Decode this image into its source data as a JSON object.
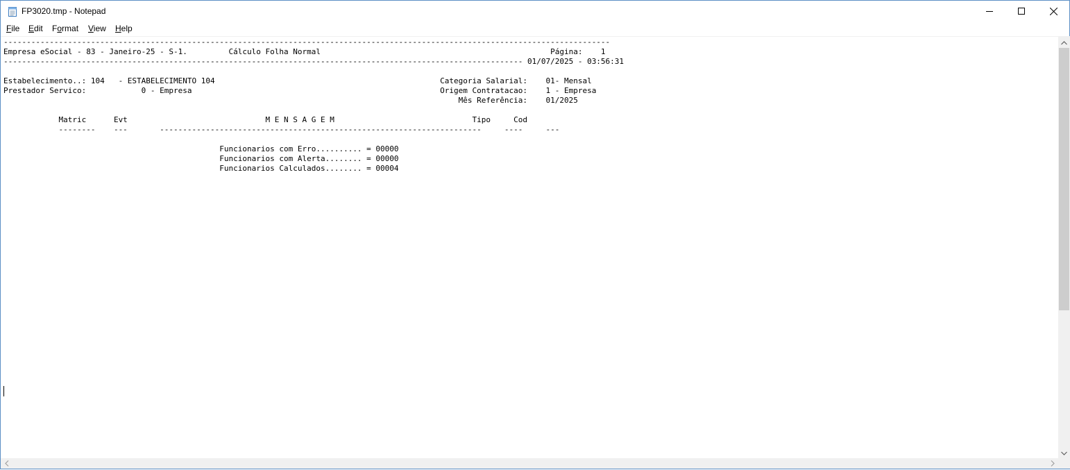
{
  "window": {
    "title": "FP3020.tmp - Notepad",
    "app_icon": "notepad-icon",
    "controls": {
      "minimize": "minimize-icon",
      "maximize": "maximize-icon",
      "close": "close-icon"
    }
  },
  "menu": {
    "file": {
      "mnemonic": "F",
      "rest": "ile"
    },
    "edit": {
      "mnemonic": "E",
      "rest": "dit"
    },
    "format": {
      "mnemonic": "o",
      "pre": "F",
      "rest": "rmat"
    },
    "view": {
      "mnemonic": "V",
      "rest": "iew"
    },
    "help": {
      "mnemonic": "H",
      "rest": "elp"
    }
  },
  "document": {
    "lines": [
      "------------------------------------------------------------------------------------------------------------------------------------",
      "Empresa eSocial - 83 - Janeiro-25 - S-1.         Cálculo Folha Normal                                                  Página:    1",
      "----------------------------------------------------------------------------------------------------------------- 01/07/2025 - 03:56:31",
      "",
      "Estabelecimento..: 104   - ESTABELECIMENTO 104                                                 Categoria Salarial:    01- Mensal",
      "Prestador Servico:            0 - Empresa                                                      Origem Contratacao:    1 - Empresa",
      "                                                                                                   Mês Referência:    01/2025",
      "",
      "            Matric      Evt                              M E N S A G E M                              Tipo     Cod",
      "            --------    ---       ----------------------------------------------------------------------     ----     ---",
      "",
      "                                               Funcionarios com Erro.......... = 00000",
      "                                               Funcionarios com Alerta........ = 00000",
      "                                               Funcionarios Calculados........ = 00004"
    ]
  },
  "scrollbars": {
    "vertical_up": "chevron-up-icon",
    "vertical_down": "chevron-down-icon",
    "horizontal_left": "chevron-left-icon",
    "horizontal_right": "chevron-right-icon"
  }
}
